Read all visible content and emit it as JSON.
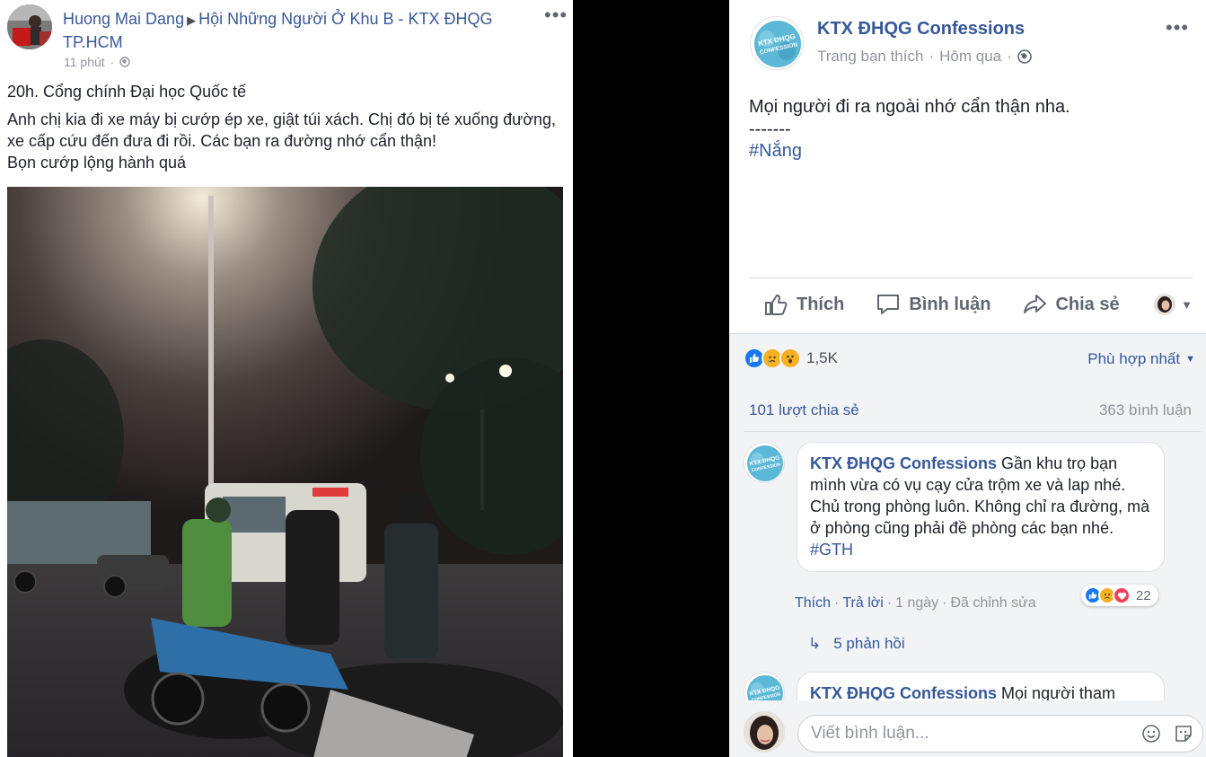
{
  "left_post": {
    "author": "Huong Mai Dang",
    "group": "Hội Những Người Ở Khu B - KTX ĐHQG TP.HCM",
    "time": "11 phút",
    "location_line": "20h. Cổng chính Đại học Quốc tế",
    "body_line1": "Anh chị kia đi xe máy bị cướp ép xe, giật túi xách. Chị đó bị té xuống đường, xe cấp cứu đến đưa đi rồi. Các bạn ra đường nhớ cẩn thận!",
    "body_line2": "Bọn cướp lộng hành quá",
    "menu_label": "•••"
  },
  "right_post": {
    "page_name": "KTX ĐHQG Confessions",
    "avatar_text": "KTX ĐHQG CONFESSION",
    "meta_liked": "Trang bạn thích",
    "meta_dot": "·",
    "meta_time": "Hôm qua",
    "menu_label": "•••",
    "text_line1": "Mọi người đi ra ngoài nhớ cẩn thận nha.",
    "text_line2": "-------",
    "hashtag": "#Nắng",
    "actions": {
      "like": "Thích",
      "comment": "Bình luận",
      "share": "Chia sẻ"
    },
    "reaction_count": "1,5K",
    "sort_label": "Phù hợp nhất",
    "shares": "101 lượt chia sẻ",
    "comments_count": "363 bình luận",
    "comments": [
      {
        "author": "KTX ĐHQG Confessions",
        "text": "Gần khu trọ bạn mình vừa có vụ cạy cửa trộm xe và lap nhé. Chủ trong phòng luôn. Không chỉ ra đường, mà ở phòng cũng phải đề phòng các bạn nhé.",
        "hashtag": "#GTH",
        "like": "Thích",
        "reply": "Trả lời",
        "time": "1 ngày",
        "edited": "Đã chỉnh sửa",
        "reactions": "22"
      },
      {
        "author": "KTX ĐHQG Confessions",
        "text": "Mọi người tham"
      }
    ],
    "replies": "5 phản hồi",
    "composer_placeholder": "Viết bình luận...",
    "colors": {
      "link": "#365899",
      "like_blue": "#1877f2",
      "love_red": "#f33e58",
      "haha_yellow": "#f7b125"
    }
  }
}
